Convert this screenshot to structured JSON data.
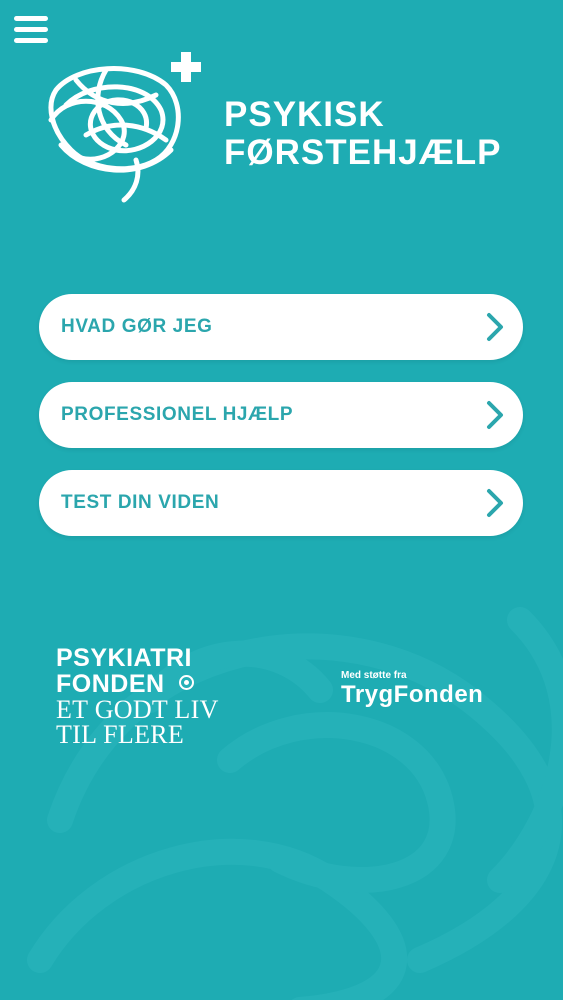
{
  "header": {
    "menu_icon": "hamburger-menu-icon",
    "logo_icon": "brain-scribble-plus-icon",
    "title_line1": "PSYKISK",
    "title_line2": "FØRSTEHJÆLP"
  },
  "menu": {
    "items": [
      {
        "label": "HVAD GØR JEG",
        "icon": "chevron-right-icon"
      },
      {
        "label": "PROFESSIONEL HJÆLP",
        "icon": "chevron-right-icon"
      },
      {
        "label": "TEST DIN VIDEN",
        "icon": "chevron-right-icon"
      }
    ]
  },
  "sponsors": {
    "psykiatrifonden": {
      "line1": "PSYKIATRI",
      "line2": "FONDEN",
      "line3": "ET GODT LIV",
      "line4": "TIL FLERE"
    },
    "trygfonden": {
      "support_text": "Med støtte fra",
      "name": "TrygFonden"
    }
  },
  "colors": {
    "background": "#1eacb3",
    "accent_text": "#2ba6ad",
    "button_bg": "#ffffff"
  }
}
